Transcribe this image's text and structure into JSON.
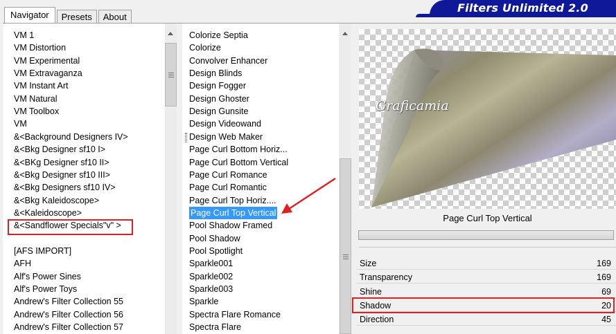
{
  "tabs": [
    "Navigator",
    "Presets",
    "About"
  ],
  "title": "Filters Unlimited 2.0",
  "categories": [
    "VM 1",
    "VM Distortion",
    "VM Experimental",
    "VM Extravaganza",
    "VM Instant Art",
    "VM Natural",
    "VM Toolbox",
    "VM",
    "&<Background Designers IV>",
    "&<Bkg Designer sf10 I>",
    "&<BKg Designer sf10 II>",
    "&<Bkg Designer sf10 III>",
    "&<Bkg Designers sf10 IV>",
    "&<Bkg Kaleidoscope>",
    "&<Kaleidoscope>",
    "&<Sandflower Specials\"v\" >",
    "",
    "[AFS IMPORT]",
    "AFH",
    "Alf's Power Sines",
    "Alf's Power Toys",
    "Andrew's Filter Collection 55",
    "Andrew's Filter Collection 56",
    "Andrew's Filter Collection 57"
  ],
  "filters": [
    "Colorize Septia",
    "Colorize",
    "Convolver Enhancer",
    "Design Blinds",
    "Design Fogger",
    "Design Ghoster",
    "Design Gunsite",
    "Design Videowand",
    "Design Web Maker",
    "Page Curl Bottom Horiz...",
    "Page Curl Bottom Vertical",
    "Page Curl Romance",
    "Page Curl Romantic",
    "Page Curl Top Horiz....",
    "Page Curl Top Vertical",
    "Pool Shadow Framed",
    "Pool Shadow",
    "Pool Spotlight",
    "Sparkle001",
    "Sparkle002",
    "Sparkle003",
    "Sparkle",
    "Spectra Flare Romance",
    "Spectra Flare"
  ],
  "selected_filter_index": 14,
  "highlighted_category_index": 15,
  "watermark": "Graficamia",
  "current_filter": "Page Curl Top Vertical",
  "params": [
    {
      "name": "Size",
      "value": "169"
    },
    {
      "name": "Transparency",
      "value": "169"
    },
    {
      "name": "Shine",
      "value": "69"
    },
    {
      "name": "Shadow",
      "value": "20"
    },
    {
      "name": "Direction",
      "value": "45"
    }
  ],
  "colors": {
    "banner": "#10189a",
    "selection": "#3399ff",
    "annotation": "#e02020"
  }
}
